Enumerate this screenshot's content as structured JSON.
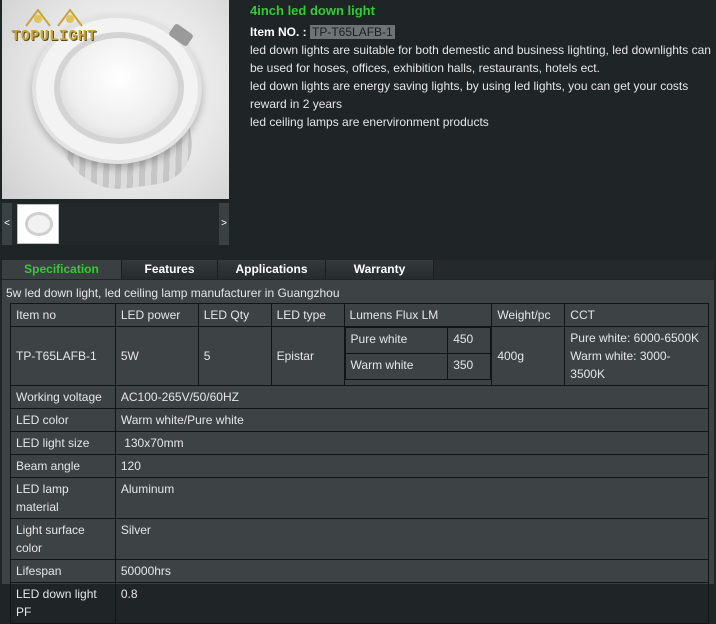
{
  "brand": {
    "logo_text": "TOPULIGHT",
    "logo_color": "#c8a53b"
  },
  "gallery": {
    "prev_label": "<",
    "next_label": ">"
  },
  "product": {
    "title": "4inch led down light",
    "item_label": "Item NO. :",
    "item_no": "TP-T65LAFB-1",
    "description": [
      "led down lights are suitable for both demestic and business lighting, led downlights can be used for hoses, offices, exhibition halls, restaurants, hotels ect.",
      "led down lights are energy saving lights, by using led lights, you can get your costs reward in 2 years",
      "led ceiling lamps are enervironment products"
    ]
  },
  "tabs": [
    {
      "label": "Specification",
      "active": true
    },
    {
      "label": "Features",
      "active": false
    },
    {
      "label": "Applications",
      "active": false
    },
    {
      "label": "Warranty",
      "active": false
    }
  ],
  "spec": {
    "caption": "5w led down light, led ceiling lamp manufacturer in Guangzhou",
    "headers": [
      "Item no",
      "LED power",
      "LED Qty",
      "LED type",
      "Lumens Flux LM",
      "Weight/pc",
      "CCT"
    ],
    "main_row": {
      "item_no": "TP-T65LAFB-1",
      "power": "5W",
      "qty": "5",
      "type": "Epistar",
      "lumens": [
        {
          "label": "Pure white",
          "value": "450"
        },
        {
          "label": "Warm white",
          "value": "350"
        }
      ],
      "weight": "400g",
      "cct": "Pure white: 6000-6500K Warm white: 3000-3500K"
    },
    "rows": [
      {
        "label": "Working voltage",
        "value": "AC100-265V/50/60HZ"
      },
      {
        "label": "LED color",
        "value": "Warm white/Pure white"
      },
      {
        "label": "LED light size",
        "value": " 130x70mm"
      },
      {
        "label": "Beam angle",
        "value": "120"
      },
      {
        "label": "LED lamp material",
        "value": "Aluminum"
      },
      {
        "label": "Light surface color",
        "value": "Silver"
      },
      {
        "label": "Lifespan",
        "value": "50000hrs"
      },
      {
        "label": "LED down light PF",
        "value": "0.8"
      }
    ]
  },
  "colors": {
    "accent_green": "#33cc33",
    "background": "#1f2426",
    "panel": "#3d4345"
  }
}
